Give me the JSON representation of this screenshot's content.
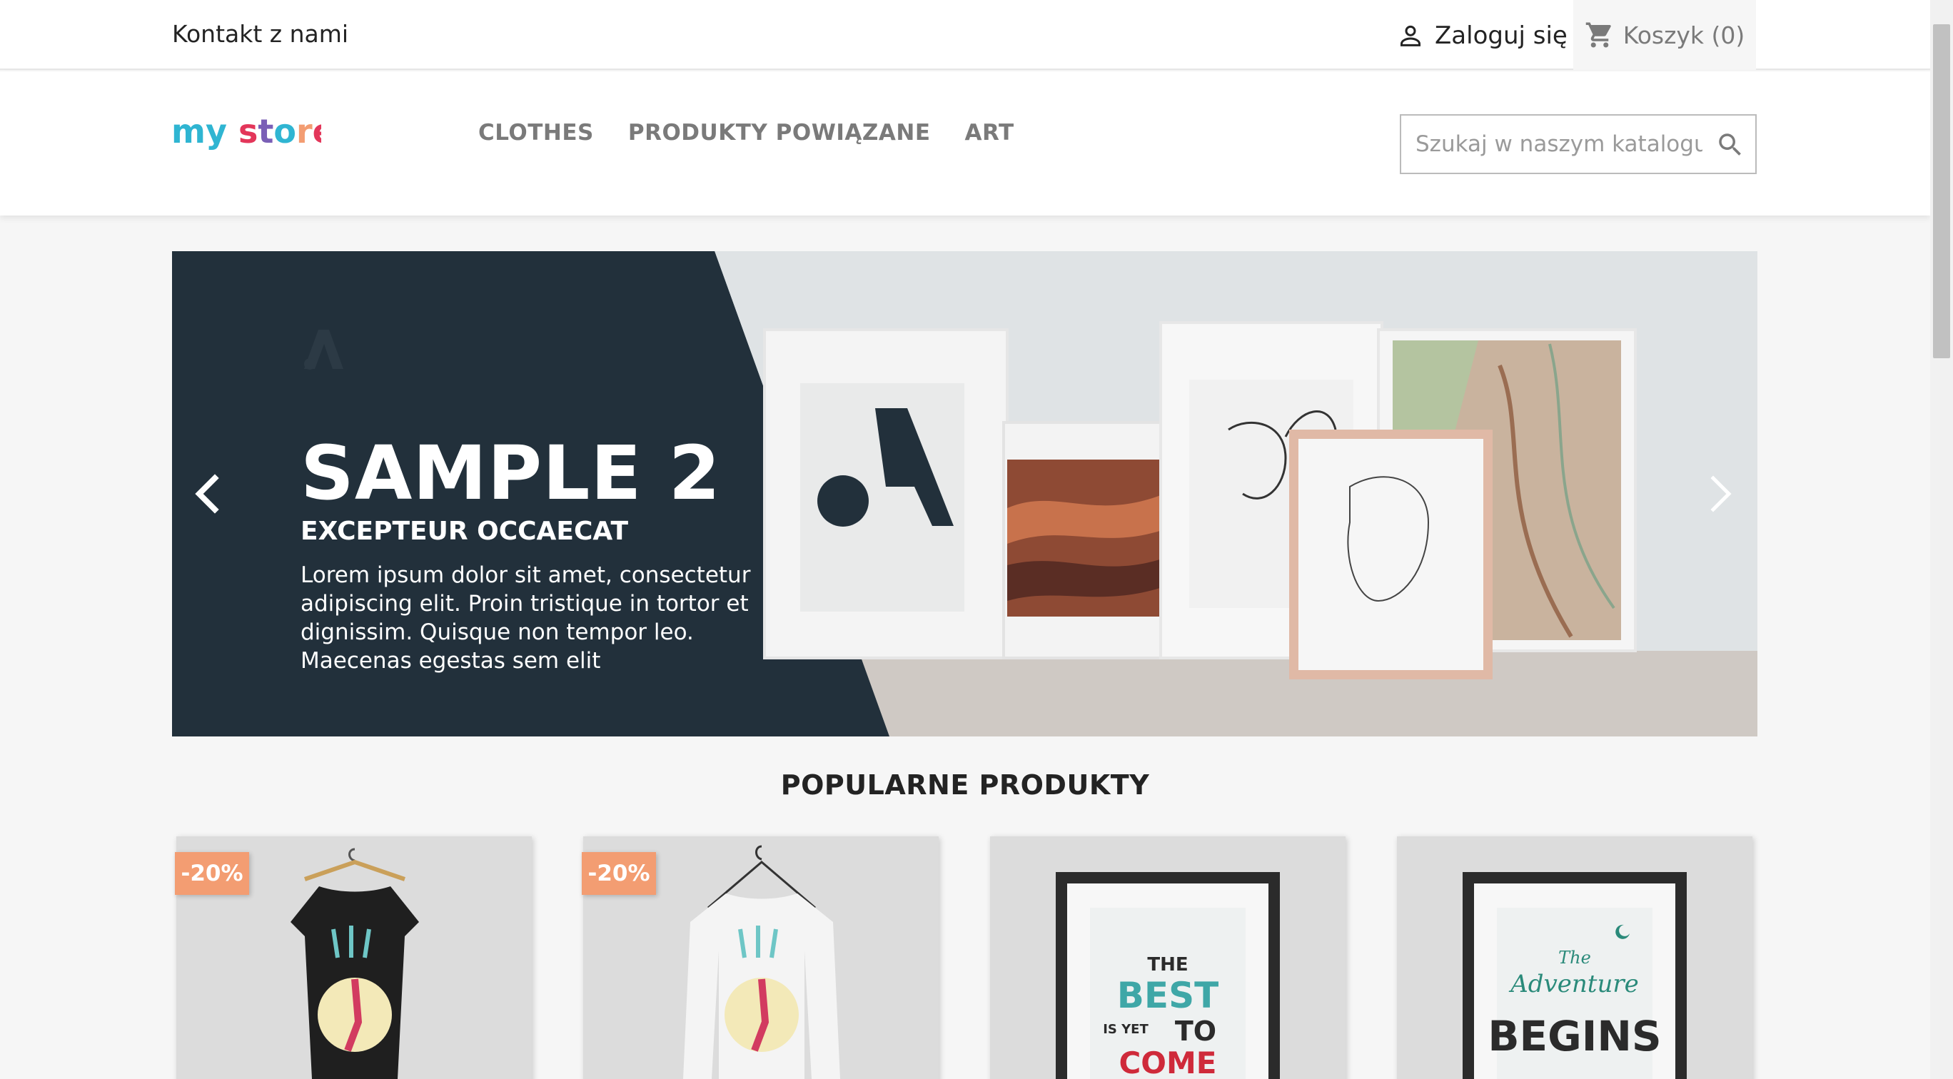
{
  "top_nav": {
    "contact_label": "Kontakt z nami",
    "signin_label": "Zaloguj się",
    "cart_label": "Koszyk (0)"
  },
  "header": {
    "logo_text": "my store",
    "menu": [
      "CLOTHES",
      "PRODUKTY POWIĄZANE",
      "ART"
    ],
    "search_placeholder": "Szukaj w naszym katalogu"
  },
  "slider": {
    "title": "SAMPLE 2",
    "subtitle": "EXCEPTEUR OCCAECAT",
    "text": "Lorem ipsum dolor sit amet, consectetur adipiscing elit. Proin tristique in tortor et dignissim. Quisque non tempor leo. Maecenas egestas sem elit"
  },
  "popular": {
    "title": "POPULARNE PRODUKTY",
    "products": [
      {
        "discount": "-20%",
        "poster_text": ""
      },
      {
        "discount": "-20%",
        "poster_text": ""
      },
      {
        "discount": "",
        "poster_lines": [
          "THE",
          "BEST",
          "IS YET",
          "TO",
          "COME"
        ]
      },
      {
        "discount": "",
        "poster_lines": [
          "The",
          "Adventure",
          "BEGINS"
        ]
      }
    ]
  },
  "colors": {
    "slide_dark": "#22303b",
    "discount_badge": "#f39d72",
    "menu_text": "#7a7a7a",
    "background": "#f6f6f6"
  },
  "icons": [
    "user-icon",
    "cart-icon",
    "search-icon",
    "chevron-left-icon",
    "chevron-right-icon"
  ]
}
